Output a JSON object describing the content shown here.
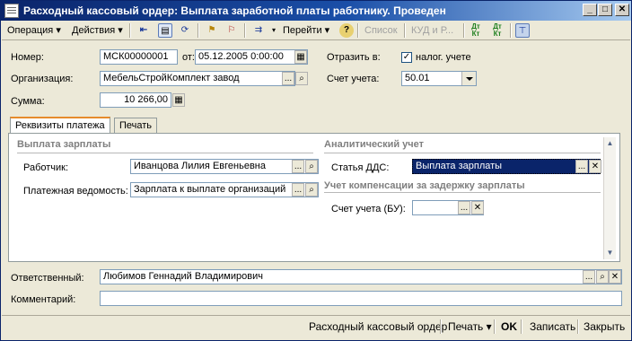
{
  "window": {
    "title": "Расходный кассовый ордер: Выплата заработной платы работнику. Проведен",
    "minimize": "_",
    "maximize": "□",
    "close": "✕"
  },
  "toolbar": {
    "operation": "Операция ▾",
    "actions": "Действия ▾",
    "goto": "Перейти ▾",
    "help_icon": "?",
    "list": "Список",
    "kud": "КУД и Р...",
    "dt_kt": "Дт Кт",
    "dt_kt2": "Дт Кт"
  },
  "header": {
    "number_label": "Номер:",
    "number_value": "МСК00000001",
    "date_label": "от:",
    "date_value": "05.12.2005  0:00:00",
    "reflect_label": "Отразить в:",
    "reflect_tax_label": "налог. учете",
    "org_label": "Организация:",
    "org_value": "МебельСтройКомплект завод",
    "account_label": "Счет учета:",
    "account_value": "50.01",
    "sum_label": "Сумма:",
    "sum_value": "10 266,00"
  },
  "tabs": {
    "payment_details": "Реквизиты платежа",
    "print": "Печать"
  },
  "payment": {
    "section_salary": "Выплата зарплаты",
    "employee_label": "Работчик:",
    "employee_value": "Иванцова Лилия Евгеньевна",
    "payroll_label": "Платежная ведомость:",
    "payroll_value": "Зарплата к выплате организаций",
    "section_analytics": "Аналитический учет",
    "dds_label": "Статья ДДС:",
    "dds_value": "Выплата зарплаты",
    "section_compensation": "Учет компенсации за задержку зарплаты",
    "bu_account_label": "Счет учета (БУ):",
    "bu_account_value": ""
  },
  "footer": {
    "responsible_label": "Ответственный:",
    "responsible_value": "Любимов Геннадий Владимирович",
    "comment_label": "Комментарий:",
    "comment_value": ""
  },
  "bottom": {
    "print_form": "Расходный кассовый ордер",
    "print_menu": "Печать ▾",
    "ok": "OK",
    "save": "Записать",
    "close": "Закрыть"
  },
  "glyphs": {
    "ellipsis": "...",
    "search": "🔍",
    "clear": "✕",
    "calendar": "▦",
    "calc": "▦",
    "check": "✓",
    "scroll_up": "▲",
    "scroll_down": "▼"
  }
}
